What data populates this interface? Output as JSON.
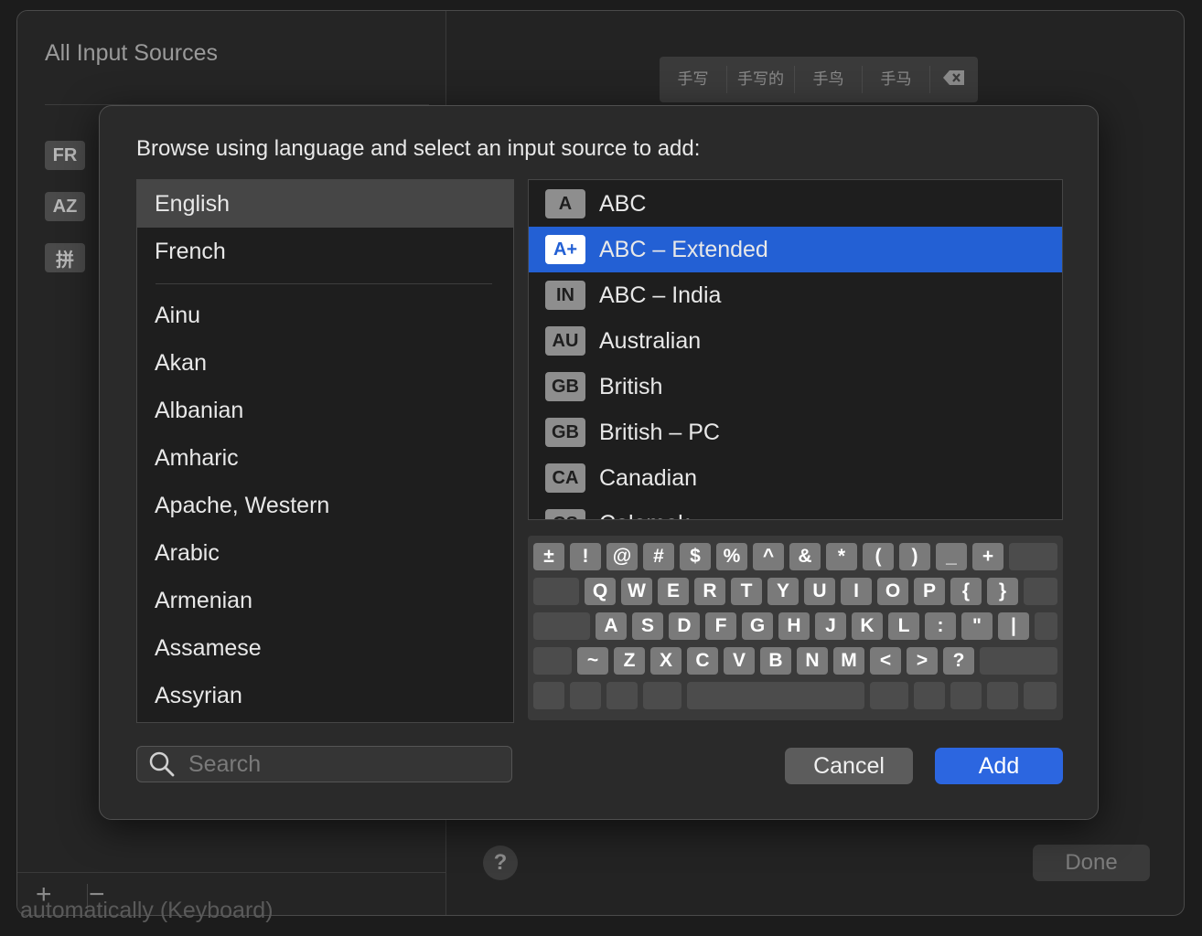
{
  "background": {
    "title": "All Input Sources",
    "icons": [
      "FR",
      "AZ",
      "拼"
    ],
    "handwriting_candidates": [
      "手写",
      "手写的",
      "手鸟",
      "手马"
    ],
    "help_label": "?",
    "done_label": "Done",
    "plus_label": "+",
    "minus_label": "−",
    "bottom_text": "automatically (Keyboard)"
  },
  "dialog": {
    "prompt": "Browse using language and select an input source to add:",
    "languages_pinned": [
      "English",
      "French"
    ],
    "languages": [
      "Ainu",
      "Akan",
      "Albanian",
      "Amharic",
      "Apache, Western",
      "Arabic",
      "Armenian",
      "Assamese",
      "Assyrian"
    ],
    "selected_language": "English",
    "sources": [
      {
        "badge": "A",
        "name": "ABC"
      },
      {
        "badge": "A+",
        "name": "ABC – Extended",
        "selected": true
      },
      {
        "badge": "IN",
        "name": "ABC – India"
      },
      {
        "badge": "AU",
        "name": "Australian"
      },
      {
        "badge": "GB",
        "name": "British"
      },
      {
        "badge": "GB",
        "name": "British – PC"
      },
      {
        "badge": "CA",
        "name": "Canadian"
      },
      {
        "badge": "CS",
        "name": "Colemak"
      }
    ],
    "keyboard": {
      "row1": [
        "±",
        "!",
        "@",
        "#",
        "$",
        "%",
        "^",
        "&",
        "*",
        "(",
        ")",
        "_",
        "+"
      ],
      "row2": [
        "Q",
        "W",
        "E",
        "R",
        "T",
        "Y",
        "U",
        "I",
        "O",
        "P",
        "{",
        "}"
      ],
      "row3": [
        "A",
        "S",
        "D",
        "F",
        "G",
        "H",
        "J",
        "K",
        "L",
        ":",
        "\"",
        "|"
      ],
      "row4": [
        "~",
        "Z",
        "X",
        "C",
        "V",
        "B",
        "N",
        "M",
        "<",
        ">",
        "?"
      ]
    },
    "search_placeholder": "Search",
    "cancel_label": "Cancel",
    "add_label": "Add"
  },
  "colors": {
    "selection_blue": "#2360d4",
    "add_button": "#2c66e0"
  }
}
